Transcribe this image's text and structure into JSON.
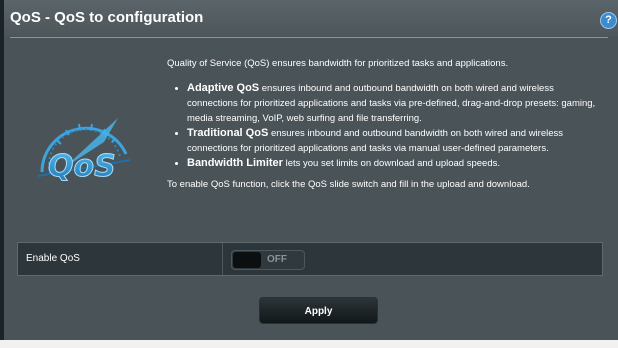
{
  "page": {
    "title": "QoS - QoS to configuration",
    "help_icon": "question-icon",
    "help_glyph": "?"
  },
  "logo": {
    "text": "QoS",
    "icon": "qos-gauge-icon"
  },
  "description": {
    "intro": "Quality of Service (QoS) ensures bandwidth for prioritized tasks and applications.",
    "features": [
      {
        "name": "Adaptive QoS",
        "text": "ensures inbound and outbound bandwidth on both wired and wireless connections for prioritized applications and tasks via pre-defined, drag-and-drop presets: gaming, media streaming, VoIP, web surfing and file transferring."
      },
      {
        "name": "Traditional QoS",
        "text": "ensures inbound and outbound bandwidth on both wired and wireless connections for prioritized applications and tasks via manual user-defined parameters."
      },
      {
        "name": "Bandwidth Limiter",
        "text": "lets you set limits on download and upload speeds."
      }
    ],
    "footer": "To enable QoS function, click the QoS slide switch and fill in the upload and download."
  },
  "settings": {
    "enable_qos_label": "Enable QoS",
    "enable_qos_state": "OFF"
  },
  "actions": {
    "apply_label": "Apply"
  },
  "colors": {
    "panel": "#4a5357",
    "accent_blue": "#3fa3dc",
    "button_dark": "#121718"
  }
}
